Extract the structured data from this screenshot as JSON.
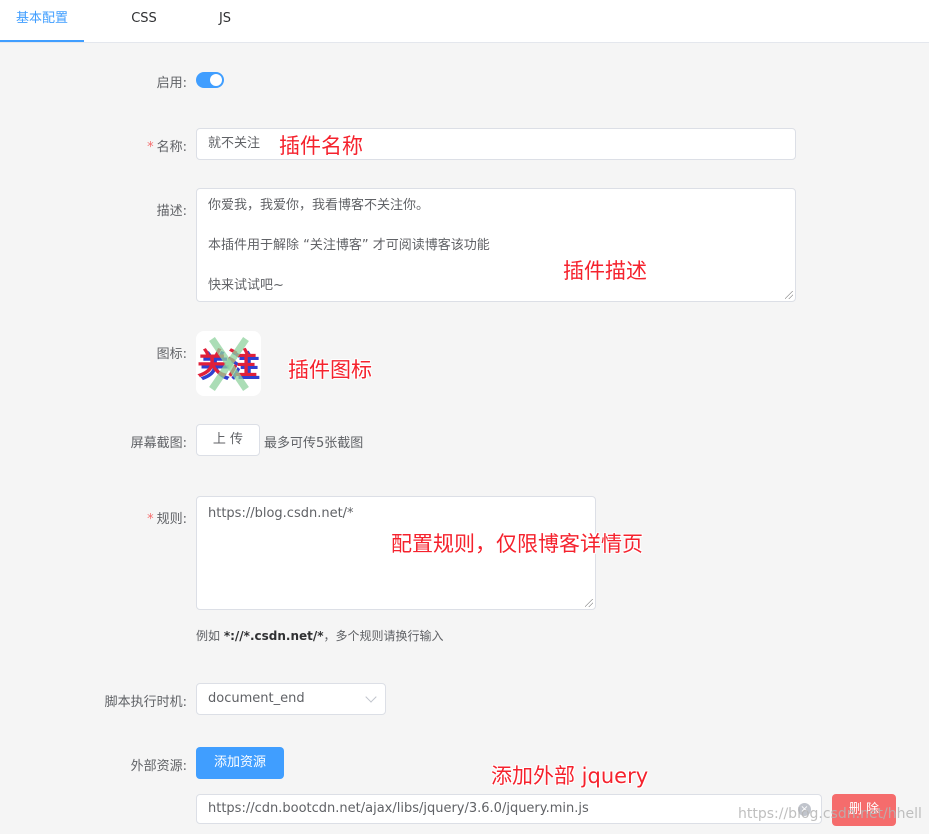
{
  "tabs": [
    "基本配置",
    "CSS",
    "JS"
  ],
  "form": {
    "enabled_label": "启用:",
    "name_label": "名称:",
    "name_value": "就不关注",
    "desc_label": "描述:",
    "desc_value": "你爱我，我爱你，我看博客不关注你。\n\n本插件用于解除 “关注博客” 才可阅读博客该功能\n\n快来试试吧~",
    "icon_label": "图标:",
    "screenshot_label": "屏幕截图:",
    "upload_button": "上 传",
    "upload_hint": "最多可传5张截图",
    "rule_label": "规则:",
    "rule_value": "https://blog.csdn.net/*",
    "rule_hint_prefix": "例如 ",
    "rule_hint_example": "*://*.csdn.net/*",
    "rule_hint_suffix": "，多个规则请换行输入",
    "timing_label": "脚本执行时机:",
    "timing_value": "document_end",
    "resource_label": "外部资源:",
    "add_resource_button": "添加资源",
    "resource_value": "https://cdn.bootcdn.net/ajax/libs/jquery/3.6.0/jquery.min.js",
    "delete_button": "删 除",
    "required_mark": "*"
  },
  "icon_text": "关注",
  "annotations": {
    "name": "插件名称",
    "desc": "插件描述",
    "icon": "插件图标",
    "rule": "配置规则，仅限博客详情页",
    "resource": "添加外部 jquery"
  },
  "watermark": "https://blog.csdn.net/hhell",
  "colors": {
    "primary": "#409eff",
    "danger": "#f56c6c",
    "annotation": "#f5222d"
  },
  "icons": {
    "switch": "toggle-on",
    "select": "chevron-down-icon",
    "clear": "clear-icon"
  }
}
